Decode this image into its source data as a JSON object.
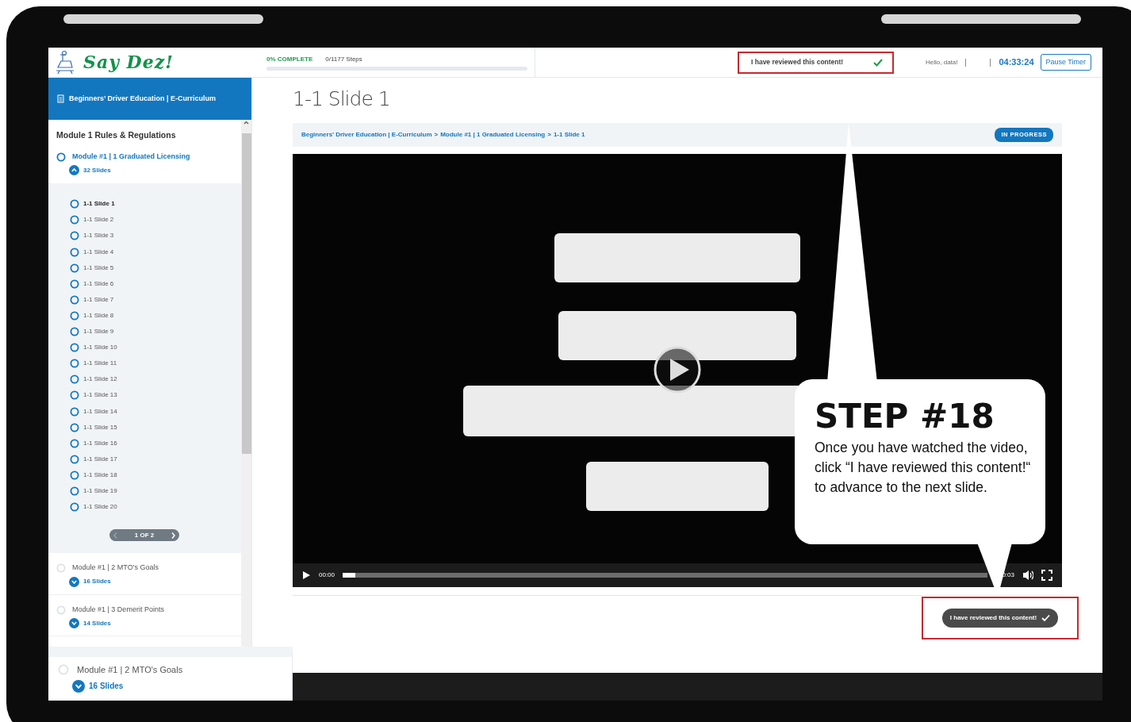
{
  "header": {
    "logo": "Say Dez!",
    "progress_label": "0% COMPLETE",
    "steps": "0/1177 Steps",
    "level": 0,
    "review_button": {
      "label": "I have reviewed this content!",
      "highlighted": true
    },
    "greeting": "Hello, data!",
    "timer": "04:33:24",
    "pause_button": "Pause Timer"
  },
  "sidebar": {
    "course_title": "Beginners’ Driver Education | E-Curriculum",
    "section_title": "Module 1 Rules & Regulations",
    "pager": "1 OF 2",
    "modules": [
      {
        "title": "Module #1 | 1 Graduated Licensing",
        "slides_count": "32 Slides",
        "selected": true,
        "expanded": true,
        "slides": [
          {
            "label": "1-1 Slide 1",
            "selected": true
          },
          {
            "label": "1-1 Slide 2",
            "selected": false
          },
          {
            "label": "1-1 Slide 3",
            "selected": false
          },
          {
            "label": "1-1 Slide 4",
            "selected": false
          },
          {
            "label": "1-1 Slide 5",
            "selected": false
          },
          {
            "label": "1-1 Slide 6",
            "selected": false
          },
          {
            "label": "1-1 Slide 7",
            "selected": false
          },
          {
            "label": "1-1 Slide 8",
            "selected": false
          },
          {
            "label": "1-1 Slide 9",
            "selected": false
          },
          {
            "label": "1-1 Slide 10",
            "selected": false
          },
          {
            "label": "1-1 Slide 11",
            "selected": false
          },
          {
            "label": "1-1 Slide 12",
            "selected": false
          },
          {
            "label": "1-1 Slide 13",
            "selected": false
          },
          {
            "label": "1-1 Slide 14",
            "selected": false
          },
          {
            "label": "1-1 Slide 15",
            "selected": false
          },
          {
            "label": "1-1 Slide 16",
            "selected": false
          },
          {
            "label": "1-1 Slide 17",
            "selected": false
          },
          {
            "label": "1-1 Slide 18",
            "selected": false
          },
          {
            "label": "1-1 Slide 19",
            "selected": false
          },
          {
            "label": "1-1 Slide 20",
            "selected": false
          }
        ]
      },
      {
        "title": "Module #1 | 2 MTO's Goals",
        "slides_count": "16 Slides",
        "selected": false,
        "expanded": false
      },
      {
        "title": "Module #1 | 3 Demerit Points",
        "slides_count": "14 Slides",
        "selected": false,
        "expanded": false
      }
    ]
  },
  "bottom_module": {
    "title": "Module #1 | 2 MTO's Goals",
    "slides_count": "16 Slides",
    "expanded": false
  },
  "main": {
    "title": "1-1 Slide 1",
    "breadcrumb": [
      "Beginners’ Driver Education | E-Curriculum",
      "Module #1 | 1 Graduated Licensing",
      "1-1 Slide 1"
    ],
    "breadcrumb_separator": ">",
    "status_badge": "IN PROGRESS",
    "video": {
      "current_time": "00:00",
      "duration": "0:03",
      "level": 0.02
    },
    "review_button": {
      "label": "I have reviewed this content!",
      "highlighted": true
    }
  },
  "callout": {
    "title": "STEP #18",
    "text": "Once you have watched the video, click “I have reviewed this content!“ to advance to the next slide."
  }
}
